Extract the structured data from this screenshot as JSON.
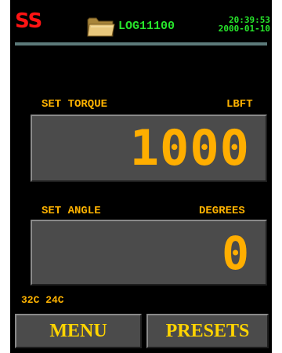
{
  "header": {
    "brand": "SS",
    "folder_icon": "folder-icon",
    "log_name": "LOG11100",
    "time": "20:39:53",
    "date": "2000-01-10"
  },
  "torque": {
    "label": "SET TORQUE",
    "unit": "LBFT",
    "value": "1000"
  },
  "angle": {
    "label": "SET ANGLE",
    "unit": "DEGREES",
    "value": "0"
  },
  "status": {
    "temps": "32C 24C"
  },
  "buttons": {
    "menu": "MENU",
    "presets": "PRESETS"
  },
  "colors": {
    "brand": "#ff1414",
    "header_text": "#27e62b",
    "label": "#ffb300",
    "value": "#ffae00",
    "button_text": "#ffd400",
    "panel": "#4b4b4b",
    "background": "#000000"
  }
}
